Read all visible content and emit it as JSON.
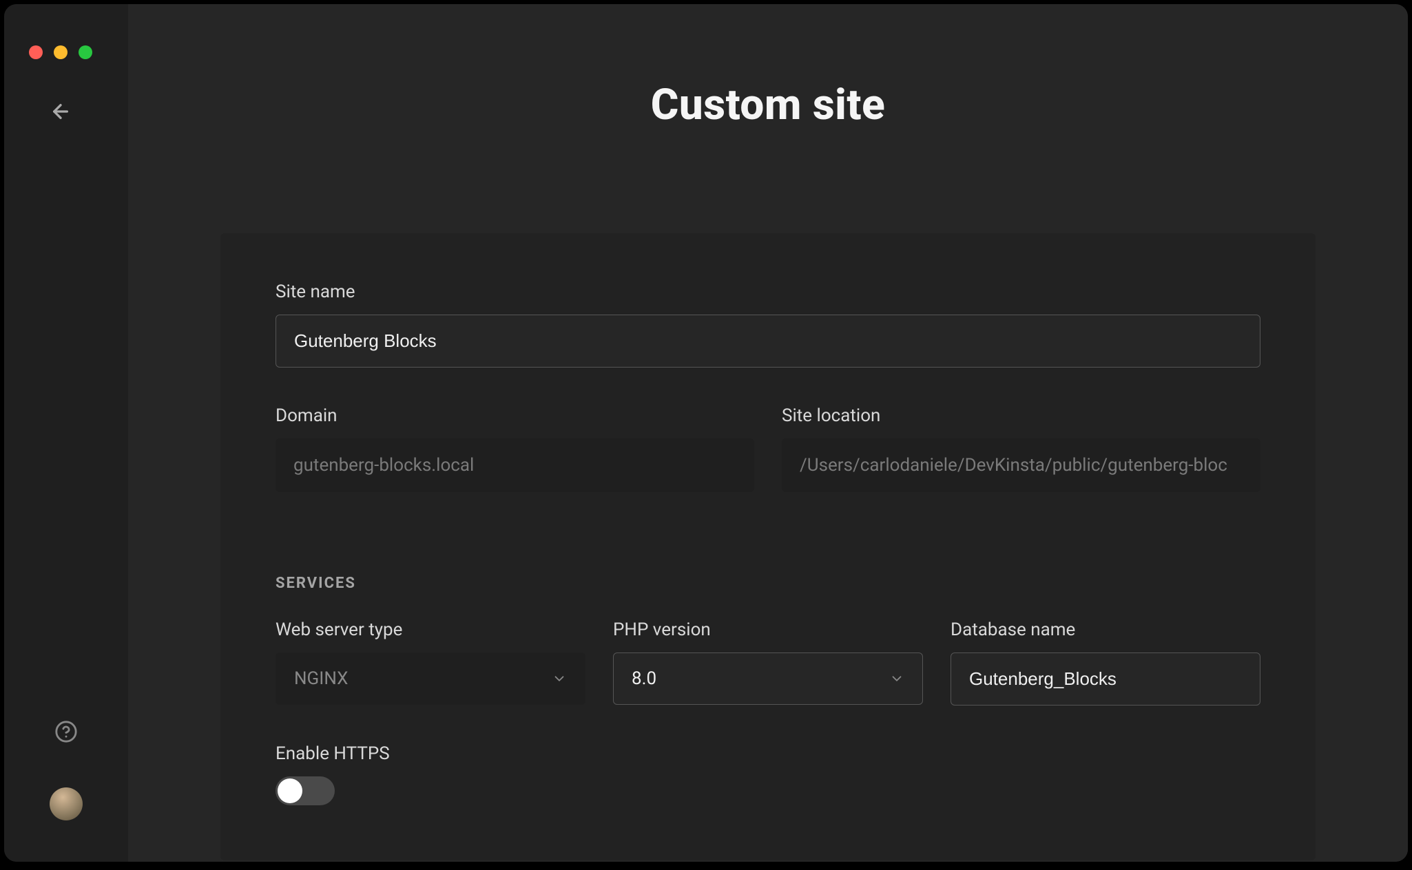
{
  "page": {
    "title": "Custom site"
  },
  "form": {
    "site_name": {
      "label": "Site name",
      "value": "Gutenberg Blocks"
    },
    "domain": {
      "label": "Domain",
      "value": "gutenberg-blocks.local"
    },
    "site_location": {
      "label": "Site location",
      "value": "/Users/carlodaniele/DevKinsta/public/gutenberg-bloc"
    },
    "services": {
      "section_label": "SERVICES",
      "web_server_type": {
        "label": "Web server type",
        "value": "NGINX"
      },
      "php_version": {
        "label": "PHP version",
        "value": "8.0"
      },
      "database_name": {
        "label": "Database name",
        "value": "Gutenberg_Blocks"
      },
      "enable_https": {
        "label": "Enable HTTPS",
        "value": false
      }
    }
  }
}
